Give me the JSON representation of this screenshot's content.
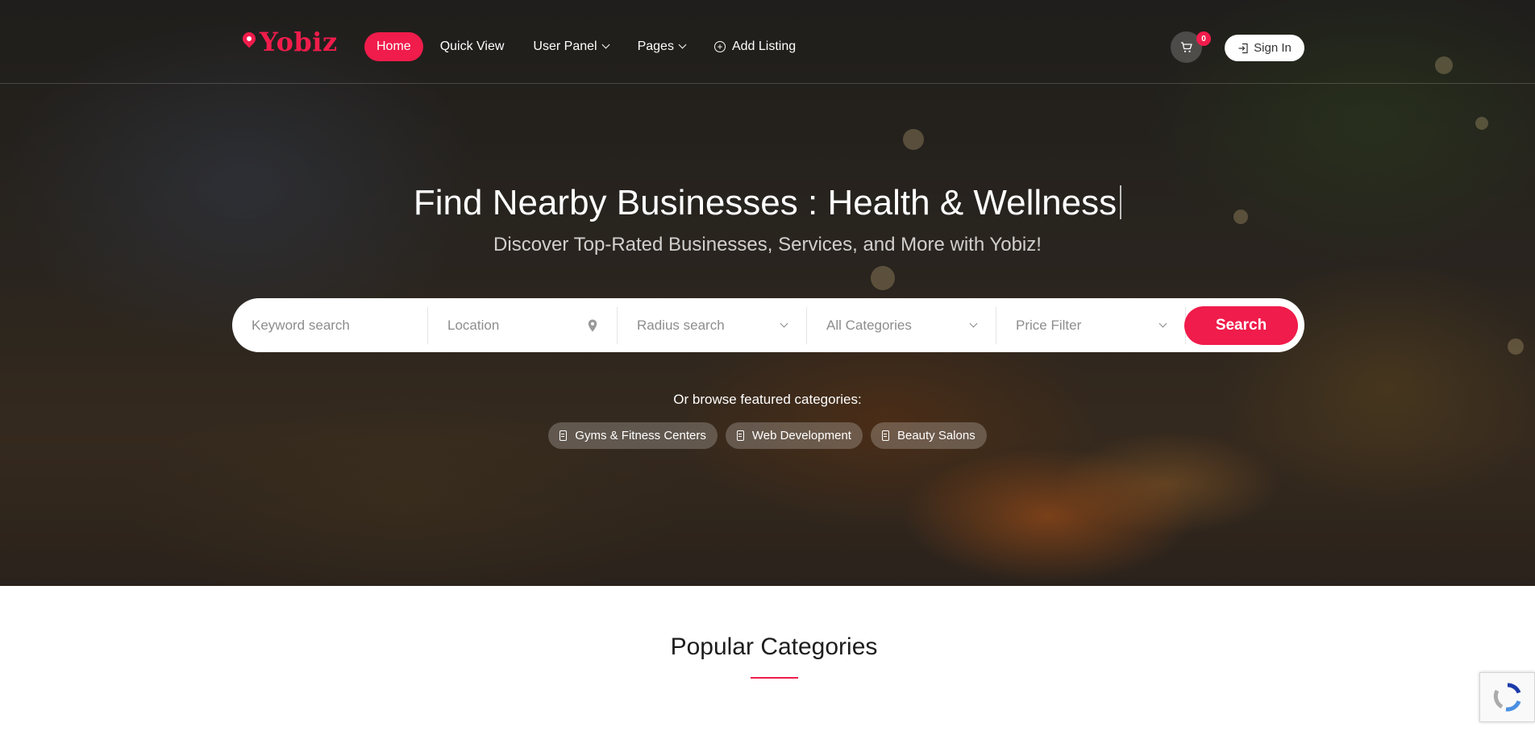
{
  "brand": {
    "name": "Yobiz",
    "accent": "#f01c4b"
  },
  "nav": {
    "items": [
      {
        "label": "Home",
        "active": true
      },
      {
        "label": "Quick View"
      },
      {
        "label": "User Panel",
        "dropdown": true
      },
      {
        "label": "Pages",
        "dropdown": true
      },
      {
        "label": "Add Listing",
        "icon": "plus-circle-icon"
      }
    ]
  },
  "header": {
    "cart_count": "0",
    "signin_label": "Sign In"
  },
  "hero": {
    "title": "Find Nearby Businesses : Health & Wellness",
    "subtitle": "Discover Top-Rated Businesses, Services, and More with Yobiz!"
  },
  "search": {
    "keyword_placeholder": "Keyword search",
    "location_placeholder": "Location",
    "radius_label": "Radius search",
    "categories_label": "All Categories",
    "price_label": "Price Filter",
    "button_label": "Search"
  },
  "featured": {
    "label": "Or browse featured categories:",
    "chips": [
      "Gyms & Fitness Centers",
      "Web Development",
      "Beauty Salons"
    ]
  },
  "popular": {
    "title": "Popular Categories"
  }
}
